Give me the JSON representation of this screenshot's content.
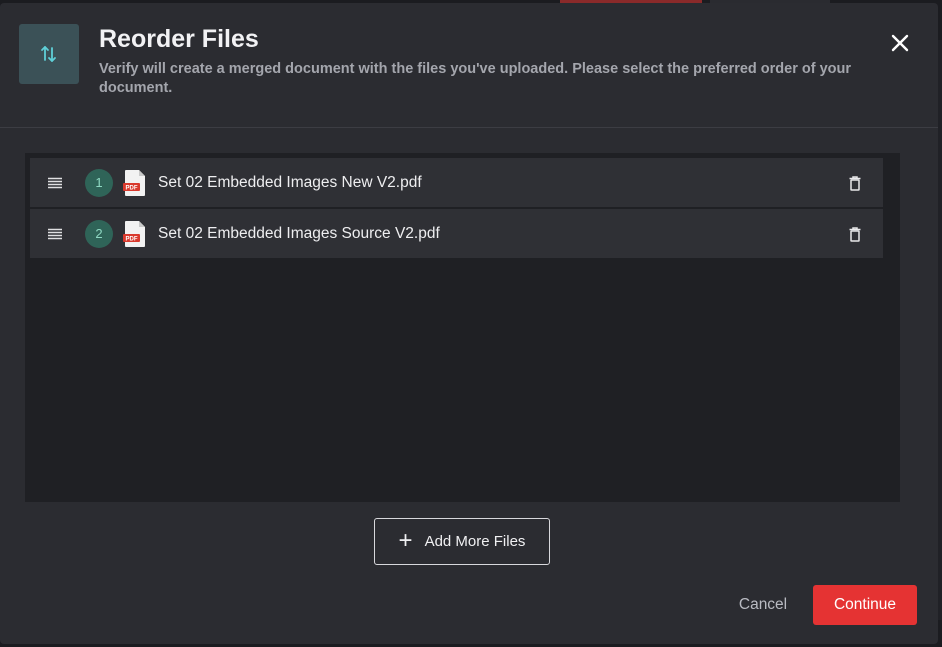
{
  "header": {
    "title": "Reorder Files",
    "subtitle": "Verify will create a merged document with the files you've uploaded. Please select the preferred order of your document.",
    "icon": "reorder-arrows-icon"
  },
  "files": [
    {
      "order": "1",
      "name": "Set 02 Embedded Images New V2.pdf",
      "icon": "pdf-icon",
      "icon_label": "PDF"
    },
    {
      "order": "2",
      "name": "Set 02 Embedded Images Source V2.pdf",
      "icon": "pdf-icon",
      "icon_label": "PDF"
    }
  ],
  "actions": {
    "add_more_label": "Add More Files",
    "cancel_label": "Cancel",
    "continue_label": "Continue"
  },
  "colors": {
    "accent": "#e53333",
    "badge": "#2f6458",
    "modal_bg": "#2b2c31"
  }
}
